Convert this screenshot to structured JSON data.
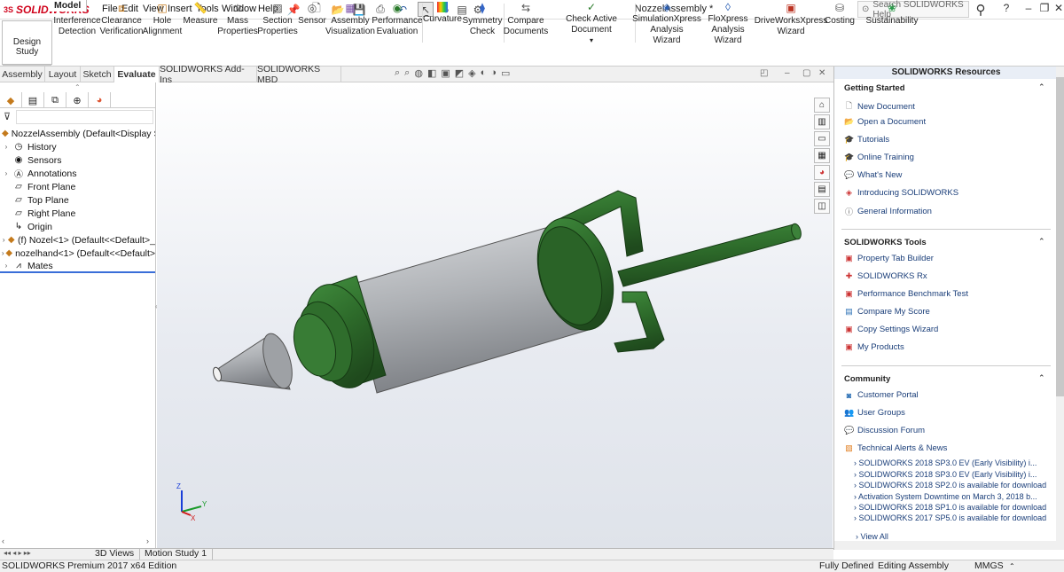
{
  "app": {
    "logo_text": "SOLIDWORKS",
    "logo_mark": "3S",
    "document_title": "NozzelAssembly *"
  },
  "menu": [
    "File",
    "Edit",
    "View",
    "Insert",
    "Tools",
    "Window",
    "Help"
  ],
  "search": {
    "placeholder": "Search SOLIDWORKS Help"
  },
  "ribbon": {
    "design_study": "Design Study",
    "buttons": [
      {
        "label1": "Interference",
        "label2": "Detection",
        "icon": "interference-icon"
      },
      {
        "label1": "Clearance",
        "label2": "Verification",
        "icon": "clearance-icon"
      },
      {
        "label1": "Hole",
        "label2": "Alignment",
        "icon": "hole-icon"
      },
      {
        "label1": "Measure",
        "label2": "",
        "icon": "measure-icon"
      },
      {
        "label1": "Mass",
        "label2": "Properties",
        "icon": "mass-icon"
      },
      {
        "label1": "Section",
        "label2": "Properties",
        "icon": "section-icon"
      },
      {
        "label1": "Sensor",
        "label2": "",
        "icon": "sensor-icon"
      },
      {
        "label1": "Assembly",
        "label2": "Visualization",
        "icon": "visualization-icon"
      },
      {
        "label1": "Performance",
        "label2": "Evaluation",
        "icon": "performance-icon"
      },
      {
        "label1": "Curvature",
        "label2": "",
        "icon": "curvature-icon"
      },
      {
        "label1": "Symmetry",
        "label2": "Check",
        "icon": "symmetry-icon"
      },
      {
        "label1": "Compare",
        "label2": "Documents",
        "icon": "compare-icon"
      },
      {
        "label1": "Check Active Document",
        "label2": "",
        "icon": "check-icon"
      },
      {
        "label1": "SimulationXpress",
        "label2": "Analysis Wizard",
        "icon": "simulation-icon"
      },
      {
        "label1": "FloXpress",
        "label2": "Analysis Wizard",
        "icon": "floxpress-icon"
      },
      {
        "label1": "DriveWorksXpress",
        "label2": "Wizard",
        "icon": "driveworks-icon"
      },
      {
        "label1": "Costing",
        "label2": "",
        "icon": "costing-icon"
      },
      {
        "label1": "Sustainability",
        "label2": "",
        "icon": "sustainability-icon"
      }
    ]
  },
  "tabs": [
    "Assembly",
    "Layout",
    "Sketch",
    "Evaluate",
    "SOLIDWORKS Add-Ins",
    "SOLIDWORKS MBD"
  ],
  "tree": {
    "root": "NozzelAssembly  (Default<Display Sta",
    "items": [
      {
        "label": "History",
        "arrow": "›"
      },
      {
        "label": "Sensors",
        "arrow": ""
      },
      {
        "label": "Annotations",
        "arrow": "›"
      },
      {
        "label": "Front Plane",
        "arrow": ""
      },
      {
        "label": "Top Plane",
        "arrow": ""
      },
      {
        "label": "Right Plane",
        "arrow": ""
      },
      {
        "label": "Origin",
        "arrow": ""
      },
      {
        "label": "(f) Nozel<1> (Default<<Default>_",
        "arrow": "›"
      },
      {
        "label": "nozelhand<1> (Default<<Default>",
        "arrow": "›"
      },
      {
        "label": "Mates",
        "arrow": "›"
      }
    ]
  },
  "triad": {
    "x": "X",
    "y": "Y",
    "z": "Z"
  },
  "resources": {
    "title": "SOLIDWORKS Resources",
    "getting_started": {
      "title": "Getting Started",
      "items": [
        "New Document",
        "Open a Document",
        "Tutorials",
        "Online Training",
        "What's New",
        "Introducing SOLIDWORKS",
        "General Information"
      ]
    },
    "tools": {
      "title": "SOLIDWORKS Tools",
      "items": [
        "Property Tab Builder",
        "SOLIDWORKS Rx",
        "Performance Benchmark Test",
        "Compare My Score",
        "Copy Settings Wizard",
        "My Products"
      ]
    },
    "community": {
      "title": "Community",
      "items": [
        "Customer Portal",
        "User Groups",
        "Discussion Forum",
        "Technical Alerts & News"
      ]
    },
    "news": [
      "SOLIDWORKS 2018 SP3.0 EV (Early Visibility) i...",
      "SOLIDWORKS 2018 SP3.0 EV (Early Visibility) i...",
      "SOLIDWORKS 2018 SP2.0 is available for download",
      "Activation System Downtime on March 3, 2018 b...",
      "SOLIDWORKS 2018 SP1.0 is available for download",
      "SOLIDWORKS 2017 SP5.0 is available for download"
    ],
    "view_all": "View All"
  },
  "bottom_tabs": [
    "Model",
    "3D Views",
    "Motion Study 1"
  ],
  "status": {
    "edition": "SOLIDWORKS Premium 2017 x64 Edition",
    "state": "Fully Defined",
    "mode": "Editing Assembly",
    "units": "MMGS"
  }
}
